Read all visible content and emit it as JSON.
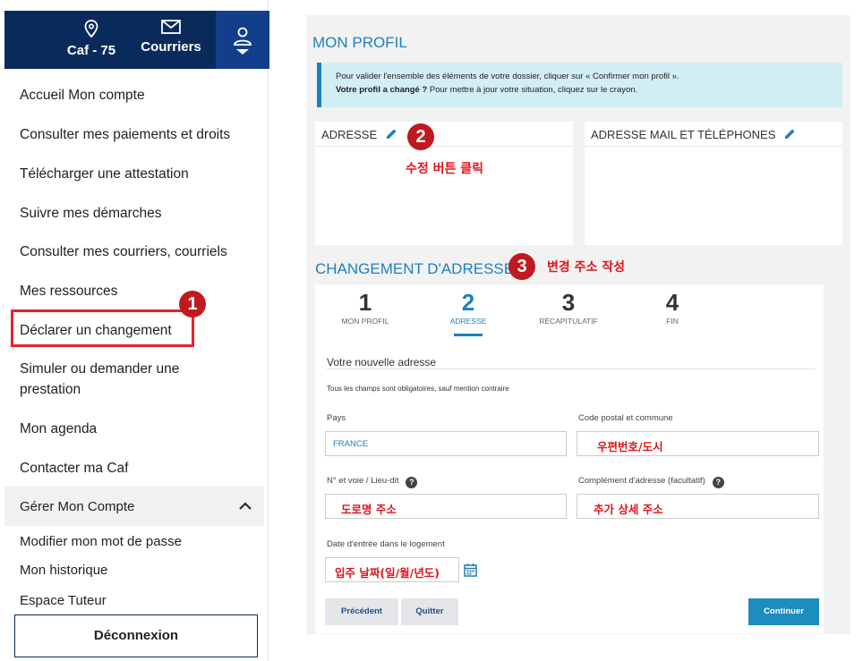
{
  "topbar": {
    "caf_label": "Caf - 75",
    "mail_label": "Courriers",
    "location_icon": "location-pin-icon",
    "mail_icon": "envelope-icon",
    "profile_icon": "user-icon"
  },
  "menu": {
    "items": [
      "Accueil Mon compte",
      "Consulter mes paiements et droits",
      "Télécharger une attestation",
      "Suivre mes démarches",
      "Consulter mes courriers, courriels",
      "Mes ressources",
      "Déclarer un changement",
      "Simuler ou demander une",
      "prestation",
      "Mon agenda",
      "Contacter ma Caf"
    ],
    "manage_label": "Gérer Mon Compte",
    "sub_items": [
      "Modifier mon mot de passe",
      "Mon historique",
      "Espace Tuteur"
    ],
    "logout_label": "Déconnexion"
  },
  "annotations": {
    "badge1": "1",
    "badge2": "2",
    "badge3": "3",
    "note2": "수정 버튼 클릭",
    "note3": "변경 주소 작성"
  },
  "profile": {
    "title": "MON PROFIL",
    "info_line1": "Pour valider l'ensemble des éléments de votre dossier, cliquer sur « Confirmer mon profil ».",
    "info_line2_bold": "Votre profil a changé ?",
    "info_line2_rest": " Pour mettre à jour votre situation, cliquez sur le crayon.",
    "card_address_title": "ADRESSE",
    "card_contact_title": "ADRESSE MAIL ET TÉLÉPHONES"
  },
  "change": {
    "title": "CHANGEMENT D'ADRESSE",
    "steps": [
      {
        "num": "1",
        "label": "MON PROFIL"
      },
      {
        "num": "2",
        "label": "ADRESSE"
      },
      {
        "num": "3",
        "label": "RÉCAPITULATIF"
      },
      {
        "num": "4",
        "label": "FIN"
      }
    ],
    "section_title": "Votre nouvelle adresse",
    "required_note": "Tous les champs sont obligatoires, sauf mention contraire",
    "pays_label": "Pays",
    "pays_value": "FRANCE",
    "cp_label": "Code postal et commune",
    "cp_value": "우편번호/도시",
    "voie_label": "N° et voie / Lieu-dit",
    "voie_value": "도로명 주소",
    "complement_label": "Complément d'adresse (facultatif)",
    "complement_value": "추가 상세 주소",
    "date_label": "Date d'entrée dans le logement",
    "date_value": "입주 날짜(일/월/년도)",
    "btn_prev": "Précédent",
    "btn_quit": "Quitter",
    "btn_continue": "Continuer"
  },
  "colors": {
    "navy": "#0b2a5c",
    "accent_blue": "#1d7fc0",
    "annotation_red": "#e0141c"
  }
}
